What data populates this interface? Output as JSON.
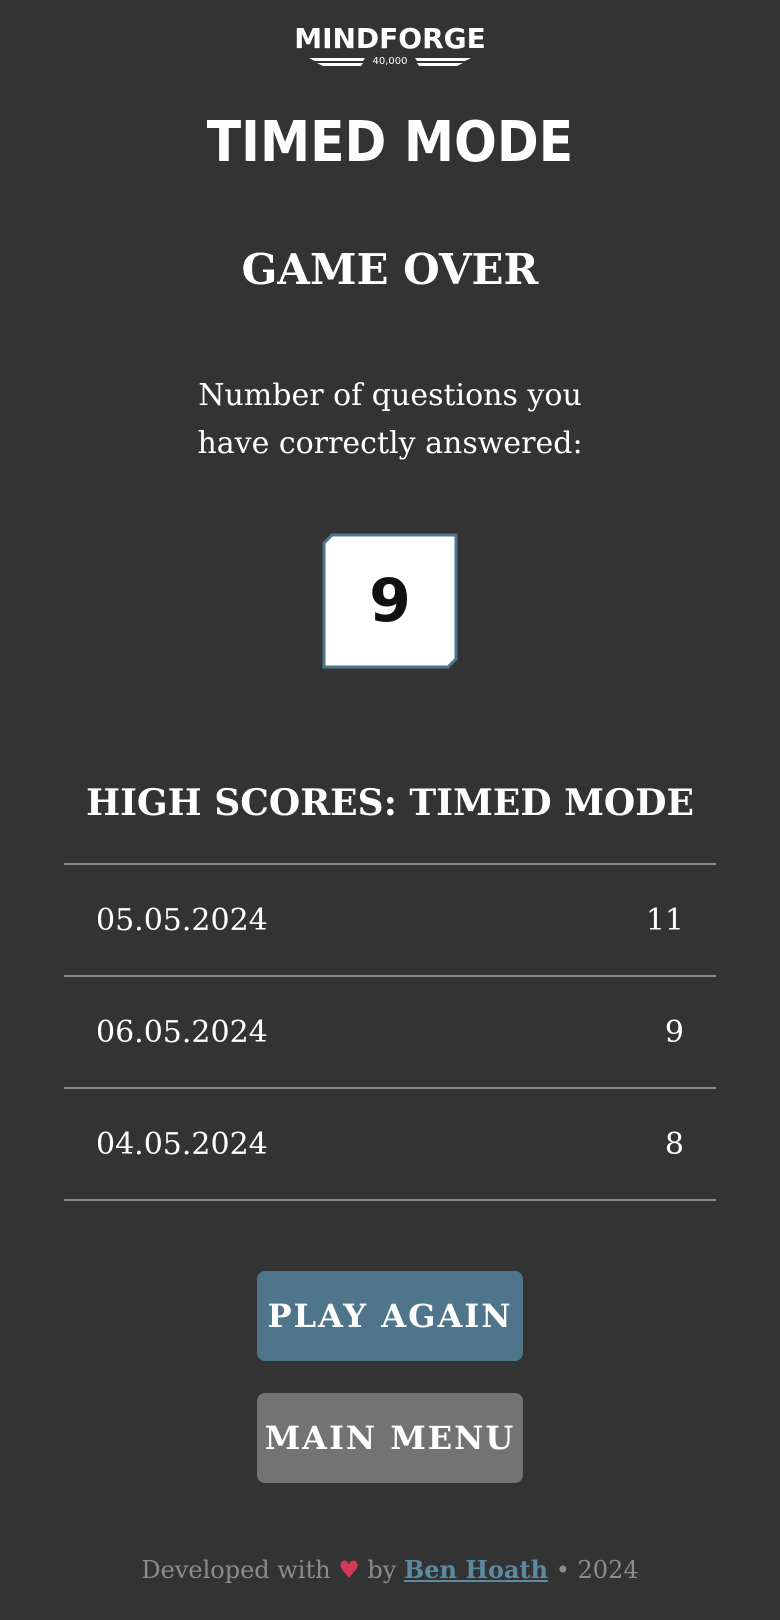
{
  "logo": {
    "wordmark": "MINDFORGE",
    "subtitle": "40,000"
  },
  "header": {
    "mode_title": "TIMED MODE"
  },
  "result": {
    "heading": "GAME OVER",
    "description": "Number of questions you have correctly answered:",
    "score": "9"
  },
  "high_scores": {
    "title": "HIGH SCORES: TIMED MODE",
    "rows": [
      {
        "date": "05.05.2024",
        "score": "11"
      },
      {
        "date": "06.05.2024",
        "score": "9"
      },
      {
        "date": "04.05.2024",
        "score": "8"
      }
    ]
  },
  "buttons": {
    "play_again": "PLAY AGAIN",
    "main_menu": "MAIN MENU"
  },
  "footer": {
    "prefix": "Developed with",
    "heart": "♥",
    "by": "by",
    "author": "Ben Hoath",
    "separator": "•",
    "year": "2024"
  },
  "colors": {
    "background": "#333333",
    "accent": "#4e7589",
    "secondary_button": "#737373",
    "heart": "#d23a5b"
  }
}
